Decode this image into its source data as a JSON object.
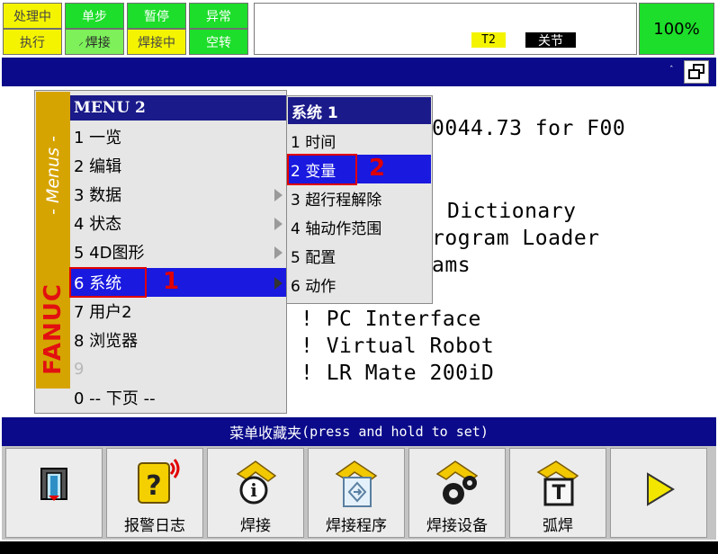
{
  "status": {
    "row1": [
      "处理中",
      "单步",
      "暂停",
      "异常"
    ],
    "row2": [
      "执行",
      "焊接",
      "焊接中",
      "空转"
    ],
    "mode_tag": "T2",
    "joint_tag": "关节",
    "override": "100%"
  },
  "background_lines": [
    "0044.73 for F00",
    "Dictionary",
    "rogram Loader",
    "ams",
    "! PC Interface",
    "! Virtual Robot",
    "! LR Mate 200iD"
  ],
  "menu": {
    "strip_label": "- Menus -",
    "brand": "FANUC",
    "header": "MENU  2",
    "items": [
      {
        "label": "1 一览"
      },
      {
        "label": "2 编辑"
      },
      {
        "label": "3 数据"
      },
      {
        "label": "4 状态"
      },
      {
        "label": "5 4D图形"
      },
      {
        "label": "6 系统"
      },
      {
        "label": "7 用户2"
      },
      {
        "label": "8 浏览器"
      },
      {
        "label": "9"
      },
      {
        "label": "0 -- 下页 --"
      }
    ]
  },
  "submenu": {
    "header": "系统  1",
    "items": [
      {
        "label": "1 时间"
      },
      {
        "label": "2 变量"
      },
      {
        "label": "3 超行程解除"
      },
      {
        "label": "4 轴动作范围"
      },
      {
        "label": "5 配置"
      },
      {
        "label": "6 动作"
      }
    ]
  },
  "annotations": {
    "step1": "1",
    "step2": "2"
  },
  "favorites": {
    "title_cn": "菜单收藏夹",
    "title_en": " (press and hold to set)",
    "buttons": [
      {
        "label": ""
      },
      {
        "label": "报警日志"
      },
      {
        "label": "焊接"
      },
      {
        "label": "焊接程序"
      },
      {
        "label": "焊接设备"
      },
      {
        "label": "弧焊"
      },
      {
        "label": ""
      }
    ]
  },
  "colors": {
    "accent_blue": "#1919e0",
    "title_navy": "#0a0a8a",
    "fanuc_gold": "#d6a400",
    "red": "#e00000"
  }
}
